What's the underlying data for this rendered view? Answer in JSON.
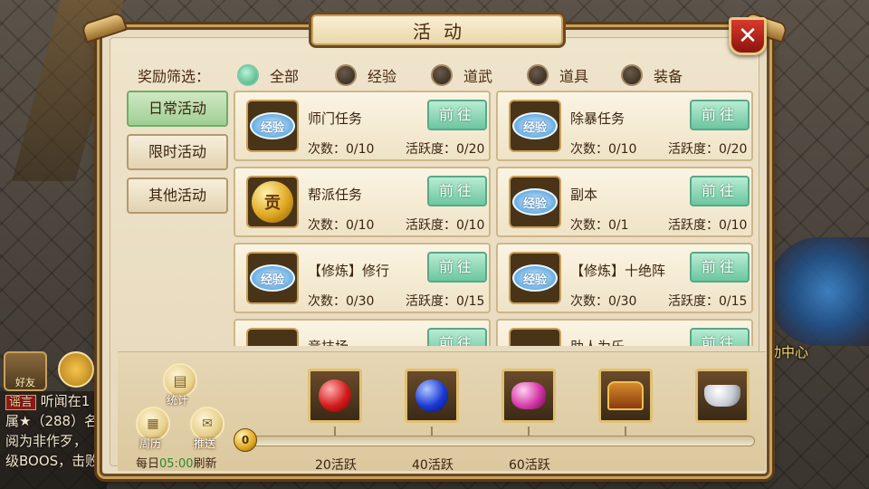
{
  "dialog": {
    "title": "活动",
    "filter": {
      "label": "奖励筛选：",
      "options": [
        {
          "label": "全部",
          "selected": true
        },
        {
          "label": "经验",
          "selected": false
        },
        {
          "label": "道武",
          "selected": false
        },
        {
          "label": "道具",
          "selected": false
        },
        {
          "label": "装备",
          "selected": false
        }
      ]
    },
    "tabs": [
      {
        "label": "日常活动",
        "active": true
      },
      {
        "label": "限时活动",
        "active": false
      },
      {
        "label": "其他活动",
        "active": false
      }
    ],
    "activities": [
      {
        "name": "师门任务",
        "icon": "exp-coin-icon",
        "badge": "经验",
        "count": "次数：0/10",
        "active": "活跃度：0/20",
        "button": "前往"
      },
      {
        "name": "除暴任务",
        "icon": "taiji-exp-icon",
        "badge": "经验",
        "count": "次数：0/10",
        "active": "活跃度：0/20",
        "button": "前往"
      },
      {
        "name": "帮派任务",
        "icon": "contribution-coin-icon",
        "badge": "贡",
        "count": "次数：0/10",
        "active": "活跃度：0/10",
        "button": "前往"
      },
      {
        "name": "副本",
        "icon": "taiji-exp-icon",
        "badge": "经验",
        "count": "次数：0/1",
        "active": "活跃度：0/10",
        "button": "前往"
      },
      {
        "name": "【修炼】修行",
        "icon": "exp-icon",
        "badge": "经验",
        "count": "次数：0/30",
        "active": "活跃度：0/15",
        "button": "前往"
      },
      {
        "name": "【修炼】十绝阵",
        "icon": "exp-icon",
        "badge": "经验",
        "count": "次数：0/30",
        "active": "活跃度：0/15",
        "button": "前往"
      },
      {
        "name": "竞技场",
        "icon": "arena-icon",
        "badge": "",
        "count": "",
        "active": "",
        "button": "前往"
      },
      {
        "name": "助人为乐",
        "icon": "help-icon",
        "badge": "",
        "count": "",
        "active": "",
        "button": "前往"
      }
    ],
    "bottom": {
      "stats_label": "统计",
      "calendar_label": "周历",
      "push_label": "推送",
      "refresh_prefix": "每日",
      "refresh_time": "05:00",
      "refresh_suffix": "刷新",
      "progress_value": "0",
      "progress_fraction": 0,
      "rewards": [
        {
          "icon": "red-gem-icon"
        },
        {
          "icon": "blue-gem-icon"
        },
        {
          "icon": "pink-gems-icon"
        },
        {
          "icon": "treasure-chest-icon"
        },
        {
          "icon": "silver-ingot-icon"
        }
      ],
      "milestones": [
        "20活跃",
        "40活跃",
        "60活跃"
      ]
    }
  },
  "background": {
    "friends_label": "好友",
    "right_label": "动中心",
    "chat_lines": [
      {
        "tag": "谣言",
        "text": "听闻在1"
      },
      {
        "tag": "",
        "text": "属★（288）名"
      },
      {
        "tag": "",
        "text": "阅为非作歹，"
      },
      {
        "tag": "",
        "text": "级BOOS，击败"
      }
    ]
  },
  "colors": {
    "accent_green": "#6cc6a0",
    "panel": "#e8dcc2",
    "border": "#6a4a24",
    "close_red": "#d83a2a"
  }
}
